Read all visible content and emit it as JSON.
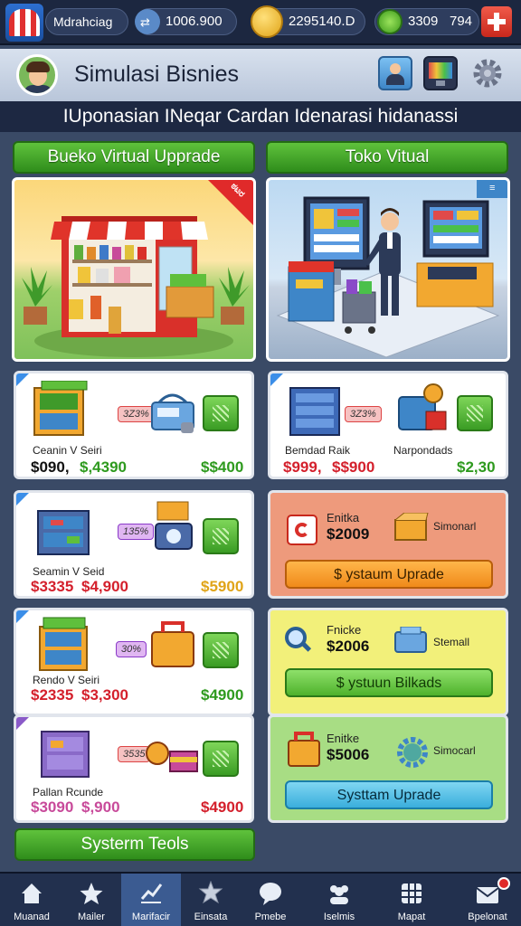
{
  "top_bar": {
    "player_name": "Mdrahciag",
    "currency_1": "1006.900",
    "currency_2": "2295140.D",
    "currency_3_a": "3309",
    "currency_3_b": "794",
    "currency_1_icon": "coin-stack-icon",
    "currency_2_icon": "gold-coin-icon",
    "currency_3_icon": "green-dollar-coin-icon",
    "add_icon": "plus-icon"
  },
  "header": {
    "title": "Simulasi Bisnies",
    "icons": [
      "profile-card-icon",
      "monitor-icon",
      "gear-icon"
    ]
  },
  "banner": "IUponasian INeqar Cardan Idenarasi hidanassi",
  "tabs": {
    "left": "Bueko Virtual Upprade",
    "right": "Toko Vitual"
  },
  "scene_left": {
    "sale_tag": "ಠಟರ"
  },
  "scene_right": {
    "sale_tag": "≡"
  },
  "left_cards": [
    {
      "badge": "3Z3%",
      "label": "Ceanin V Seiri",
      "price_a": "$090,",
      "price_b": "$,4390",
      "price_c": "$$400"
    },
    {
      "badge": "135%",
      "label": "Seamin V Seid",
      "price_a": "$3335",
      "price_b": "$4,900",
      "price_c": "$5900"
    },
    {
      "badge": "30%",
      "label": "Rendo V Seiri",
      "price_a": "$2335",
      "price_b": "$3,300",
      "price_c": "$4900"
    },
    {
      "badge": "3535",
      "label": "Pallan Rcunde",
      "price_a": "$3090",
      "price_b": "$,900",
      "price_c": "$4900"
    }
  ],
  "right_cards": [
    {
      "badge": "3Z3%",
      "label_a": "Bemdad Raik",
      "label_b": "Narpondads",
      "price_a": "$999,",
      "price_b": "$$900",
      "price_c": "$2,30"
    },
    {
      "title": "Enitka",
      "price": "$2009",
      "side_label": "Simonarl",
      "button": "$ ystaum Uprade"
    },
    {
      "title": "Fnicke",
      "price": "$2006",
      "side_label": "Stemall",
      "button": "$ ystuun Bilkads"
    },
    {
      "title": "Enitke",
      "price": "$5006",
      "side_label": "Simocarl",
      "button": "Systtam Uprade"
    }
  ],
  "system_tools": "Systerm Teols",
  "nav": [
    {
      "label": "Muanad",
      "icon": "home-icon"
    },
    {
      "label": "Mailer",
      "icon": "star-icon"
    },
    {
      "label": "Marifacir",
      "icon": "chart-icon"
    },
    {
      "label": "Einsata",
      "icon": "badge-star-icon"
    },
    {
      "label": "Pmebe",
      "icon": "chat-bubble-icon"
    },
    {
      "label": "Iselmis",
      "icon": "people-icon"
    },
    {
      "label": "Mapat",
      "icon": "grid-icon"
    },
    {
      "label": "Bpelonat",
      "icon": "mail-icon"
    }
  ],
  "colors": {
    "accent_green": "#3fa524",
    "dark_navy": "#1d2842",
    "price_red": "#d4202c",
    "price_green": "#2e9a1e",
    "card_orange": "#ee9a7c",
    "card_yellow": "#f2f07a",
    "card_lightgreen": "#a8dd84"
  }
}
